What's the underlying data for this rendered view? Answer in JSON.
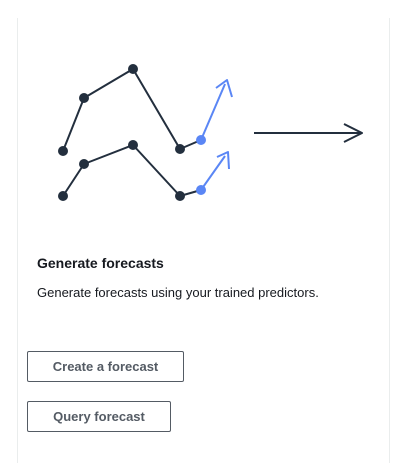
{
  "section": {
    "title": "Generate forecasts",
    "description": "Generate forecasts using your trained predictors."
  },
  "actions": {
    "create_label": "Create a forecast",
    "query_label": "Query forecast"
  },
  "colors": {
    "line_dark": "#232f3e",
    "accent_blue": "#5a86f5",
    "button_border": "#545b64",
    "card_border": "#eaeded"
  },
  "icons": {
    "illustration": "forecast-trend-illustration",
    "arrow": "arrow-right-icon"
  }
}
